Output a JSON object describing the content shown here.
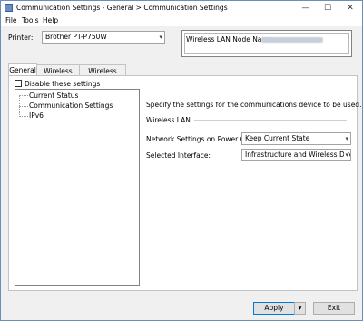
{
  "window": {
    "title": "Communication Settings - General > Communication Settings",
    "minimize_glyph": "—",
    "maximize_glyph": "☐",
    "close_glyph": "✕"
  },
  "menu": {
    "items": [
      "File",
      "Tools",
      "Help"
    ]
  },
  "printer": {
    "label": "Printer:",
    "value": "Brother PT-P750W"
  },
  "node_name": {
    "label": "Wireless LAN Node Name:",
    "value_redacted": true
  },
  "tabs": [
    "General",
    "Wireless LAN",
    "Wireless Direct"
  ],
  "active_tab": "General",
  "disable_settings": {
    "label": "Disable these settings",
    "checked": false
  },
  "tree": {
    "items": [
      "Current Status",
      "Communication Settings",
      "IPv6"
    ],
    "selected": "Communication Settings"
  },
  "content": {
    "description": "Specify the settings for the communications device to be used.",
    "section_title": "Wireless LAN",
    "network_on_power": {
      "label": "Network Settings on Power On:",
      "value": "Keep Current State"
    },
    "selected_interface": {
      "label": "Selected Interface:",
      "value": "Infrastructure and Wireless Direct"
    }
  },
  "footer": {
    "apply_label": "Apply",
    "exit_label": "Exit"
  },
  "icons": {
    "dropdown": "▾",
    "app": "app-icon"
  },
  "colors": {
    "accent": "#0078d7",
    "window_border": "#6d8fb5"
  }
}
